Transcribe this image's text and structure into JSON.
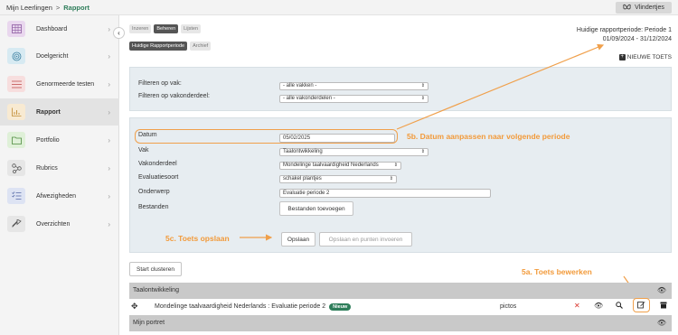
{
  "breadcrumb": {
    "root": "Mijn Leerlingen",
    "separator": ">",
    "current": "Rapport"
  },
  "header_button": {
    "label": "Vlindertjes",
    "icon": "butterfly-icon"
  },
  "sidebar": {
    "items": [
      {
        "label": "Dashboard",
        "icon": "grid-icon",
        "color": "#e9d7ee"
      },
      {
        "label": "Doelgericht",
        "icon": "target-icon",
        "color": "#d7eaf2"
      },
      {
        "label": "Genormeerde testen",
        "icon": "list-icon",
        "color": "#f7dede"
      },
      {
        "label": "Rapport",
        "icon": "chart-icon",
        "color": "#f8ead2"
      },
      {
        "label": "Portfolio",
        "icon": "folder-icon",
        "color": "#dff0d8"
      },
      {
        "label": "Rubrics",
        "icon": "nodes-icon",
        "color": "#e6e6e6"
      },
      {
        "label": "Afwezigheden",
        "icon": "checklist-icon",
        "color": "#dde3f3"
      },
      {
        "label": "Overzichten",
        "icon": "share-icon",
        "color": "#e6e6e6"
      }
    ],
    "active_index": 3
  },
  "tabs": [
    "Inzeren",
    "Beheren",
    "Lijsten"
  ],
  "active_tab": 1,
  "subtabs": [
    "Huidige Rapportperiode",
    "Archief"
  ],
  "period": {
    "line1": "Huidige rapportperiode: Periode 1",
    "line2": "01/09/2024 - 31/12/2024"
  },
  "new_test_label": "NIEUWE TOETS",
  "filters": {
    "subject_label": "Filteren op vak:",
    "subject_value": "- alle vakken -",
    "part_label": "Filteren op vakonderdeel:",
    "part_value": "- alle vakonderdelen -"
  },
  "form": {
    "date_label": "Datum",
    "date_value": "05/02/2025",
    "subject_label": "Vak",
    "subject_value": "Taalontwikkeling",
    "part_label": "Vakonderdeel",
    "part_value": "Mondelinge taalvaardigheid Nederlands",
    "type_label": "Evaluatiesoort",
    "type_value": "schakel plantjes",
    "topic_label": "Onderwerp",
    "topic_value": "Evaluatie periode 2",
    "files_label": "Bestanden",
    "add_files_button": "Bestanden toevoegen",
    "save_button": "Opslaan",
    "save_points_button": "Opslaan en punten invoeren"
  },
  "annotations": {
    "date": "5b. Datum aanpassen naar volgende periode",
    "save": "5c. Toets opslaan",
    "edit": "5a. Toets bewerken",
    "color": "#f29a3a"
  },
  "start_cluster_button": "Start clusteren",
  "sections": [
    {
      "title": "Taalontwikkeling"
    },
    {
      "title": "Mijn portret"
    }
  ],
  "test_row": {
    "title": "Mondelinge taalvaardigheid Nederlands : Evaluatie periode 2",
    "badge": "Nieuw",
    "type": "pictos"
  },
  "colors": {
    "brand_green": "#2e7d5a",
    "panel": "#e7edf1",
    "section_bar": "#c9c9c9",
    "accent_orange": "#f0a04b"
  }
}
